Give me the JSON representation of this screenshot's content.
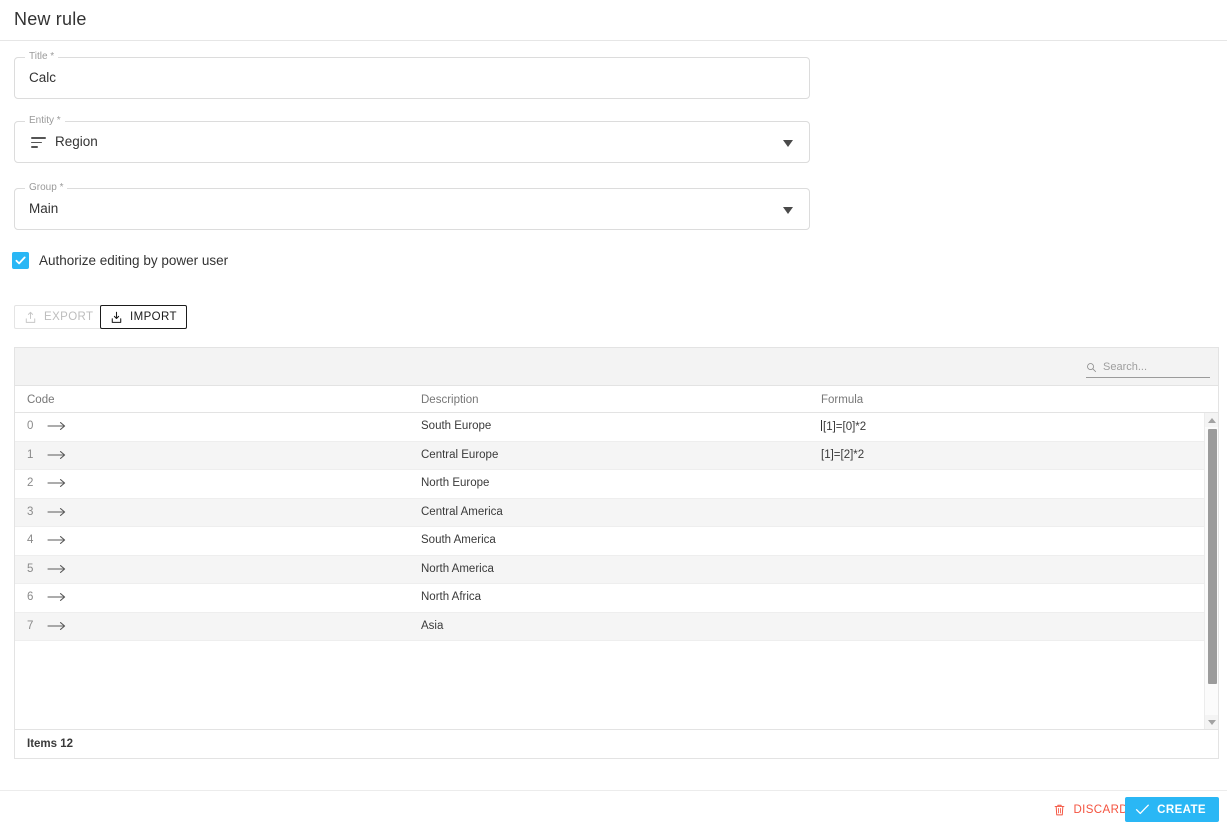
{
  "header": {
    "title": "New rule"
  },
  "colors": {
    "accent_blue": "#2ab7f5",
    "discard_red": "#f4533f",
    "row_alt_grey": "#f5f5f5",
    "toolbar_grey": "#f3f3f3"
  },
  "form": {
    "title_field": {
      "label": "Title *",
      "value": "Calc",
      "icon": ""
    },
    "entity_field": {
      "label": "Entity *",
      "value": "Region",
      "icon": "list-lines-icon"
    },
    "group_field": {
      "label": "Group *",
      "value": "Main",
      "icon": ""
    }
  },
  "checkbox": {
    "label": "Authorize editing by power user",
    "checked": true
  },
  "toolbar": {
    "export_label": "EXPORT",
    "export_icon": "upload-icon",
    "export_disabled": true,
    "import_label": "IMPORT",
    "import_icon": "download-icon"
  },
  "search": {
    "placeholder": "Search...",
    "value": "",
    "icon": "search-icon"
  },
  "table": {
    "columns": [
      "Code",
      "Description",
      "Formula"
    ],
    "rows": [
      {
        "code": "0",
        "description": "South Europe",
        "formula": "[1]=[0]*2",
        "formula_caret": true
      },
      {
        "code": "1",
        "description": "Central Europe",
        "formula": "[1]=[2]*2",
        "formula_caret": false
      },
      {
        "code": "2",
        "description": "North Europe",
        "formula": "",
        "formula_caret": false
      },
      {
        "code": "3",
        "description": "Central America",
        "formula": "",
        "formula_caret": false
      },
      {
        "code": "4",
        "description": "South America",
        "formula": "",
        "formula_caret": false
      },
      {
        "code": "5",
        "description": "North America",
        "formula": "",
        "formula_caret": false
      },
      {
        "code": "6",
        "description": "North Africa",
        "formula": "",
        "formula_caret": false
      },
      {
        "code": "7",
        "description": "Asia",
        "formula": "",
        "formula_caret": false
      }
    ],
    "footer": "Items 12"
  },
  "actions": {
    "discard_label": "DISCARD",
    "discard_icon": "trash-icon",
    "create_label": "CREATE",
    "create_icon": "check-icon"
  }
}
